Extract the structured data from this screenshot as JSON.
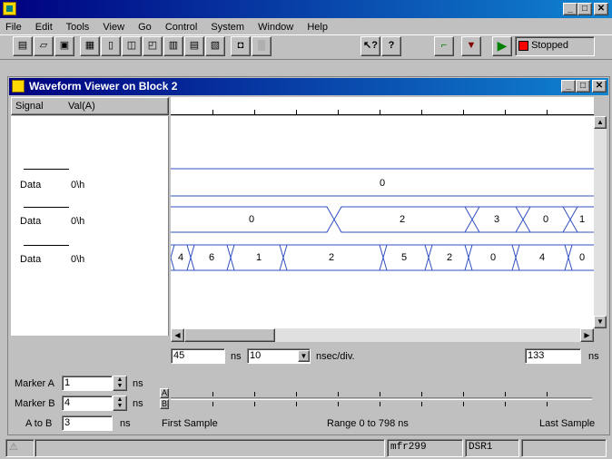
{
  "menu": [
    "File",
    "Edit",
    "Tools",
    "View",
    "Go",
    "Control",
    "System",
    "Window",
    "Help"
  ],
  "toolbar": {
    "status": "Stopped",
    "icons": [
      "new-doc-icon",
      "open-folder-icon",
      "save-disk-icon",
      "grid-tool-icon",
      "block-tool-icon",
      "chart-tool-icon",
      "panel-tool-icon",
      "module-tool-icon",
      "module2-tool-icon",
      "module3-tool-icon",
      "module4-tool-icon",
      "module5-tool-icon",
      "context-help-icon",
      "help-icon",
      "probe-icon",
      "download-icon",
      "run-icon",
      "stop-icon"
    ]
  },
  "viewer": {
    "title": "Waveform Viewer on Block 2",
    "col_signal": "Signal",
    "col_val": "Val(A)",
    "signals": [
      {
        "name": "Data",
        "val": "0\\h"
      },
      {
        "name": "Data",
        "val": "0\\h"
      },
      {
        "name": "Data",
        "val": "0\\h"
      }
    ],
    "waves": [
      [
        "0"
      ],
      [
        "0",
        "2",
        "3",
        "0",
        "1"
      ],
      [
        "4",
        "6",
        "1",
        "2",
        "5",
        "2",
        "0",
        "4",
        "0"
      ]
    ],
    "scale": {
      "start": "45",
      "start_unit": "ns",
      "div_value": "10",
      "div_unit": "nsec/div.",
      "end": "133",
      "end_unit": "ns"
    },
    "markers": {
      "a_label": "Marker A",
      "a_value": "1",
      "a_unit": "ns",
      "b_label": "Marker B",
      "b_value": "4",
      "b_unit": "ns",
      "atob_label": "A to B",
      "atob_value": "3",
      "atob_unit": "ns",
      "a_flag": "A",
      "b_flag": "B"
    },
    "range": {
      "first": "First Sample",
      "middle": "Range 0 to 798 ns",
      "last": "Last Sample"
    }
  },
  "statusbar": {
    "field1": "mfr299",
    "field2": "DSR1"
  },
  "colors": {
    "title_start": "#000080",
    "title_end": "#1084d0",
    "bus_line": "#3050c0",
    "run_green": "#008000",
    "stop_red": "#ff0000"
  }
}
